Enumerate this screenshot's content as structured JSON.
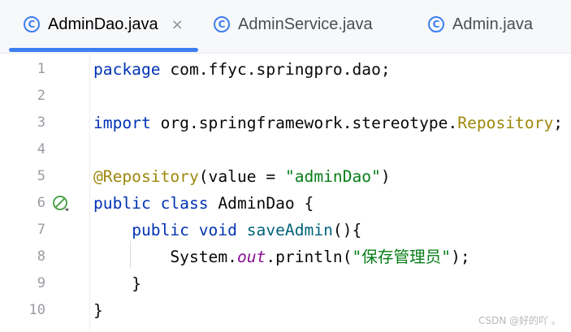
{
  "tabs": [
    {
      "label": "AdminDao.java",
      "icon": "class-c-icon",
      "active": true,
      "close": "×"
    },
    {
      "label": "AdminService.java",
      "icon": "class-c-icon",
      "active": false
    },
    {
      "label": "Admin.java",
      "icon": "class-c-icon",
      "active": false
    }
  ],
  "tab_icon_glyph": "C",
  "lines": [
    {
      "num": "1",
      "tokens": [
        {
          "t": "package",
          "c": "kw"
        },
        {
          "t": " com.ffyc.springpro.dao;",
          "c": ""
        }
      ]
    },
    {
      "num": "2",
      "tokens": []
    },
    {
      "num": "3",
      "tokens": [
        {
          "t": "import",
          "c": "kw"
        },
        {
          "t": " org.springframework.stereotype.",
          "c": ""
        },
        {
          "t": "Repository",
          "c": "ann"
        },
        {
          "t": ";",
          "c": ""
        }
      ]
    },
    {
      "num": "4",
      "tokens": []
    },
    {
      "num": "5",
      "tokens": [
        {
          "t": "@Repository",
          "c": "ann"
        },
        {
          "t": "(value = ",
          "c": ""
        },
        {
          "t": "\"adminDao\"",
          "c": "str"
        },
        {
          "t": ")",
          "c": ""
        }
      ]
    },
    {
      "num": "6",
      "tokens": [
        {
          "t": "public",
          "c": "kw"
        },
        {
          "t": " ",
          "c": ""
        },
        {
          "t": "class",
          "c": "kw"
        },
        {
          "t": " AdminDao {",
          "c": ""
        }
      ],
      "gutter_icon": "bean-icon"
    },
    {
      "num": "7",
      "tokens": [
        {
          "t": "    ",
          "c": ""
        },
        {
          "t": "public",
          "c": "kw"
        },
        {
          "t": " ",
          "c": ""
        },
        {
          "t": "void",
          "c": "kw"
        },
        {
          "t": " ",
          "c": ""
        },
        {
          "t": "saveAdmin",
          "c": "fn"
        },
        {
          "t": "(){",
          "c": ""
        }
      ]
    },
    {
      "num": "8",
      "tokens": [
        {
          "t": "        System.",
          "c": ""
        },
        {
          "t": "out",
          "c": "fld"
        },
        {
          "t": ".println(",
          "c": ""
        },
        {
          "t": "\"保存管理员\"",
          "c": "str"
        },
        {
          "t": ");",
          "c": ""
        }
      ]
    },
    {
      "num": "9",
      "tokens": [
        {
          "t": "    }",
          "c": ""
        }
      ]
    },
    {
      "num": "10",
      "tokens": [
        {
          "t": "}",
          "c": ""
        }
      ]
    }
  ],
  "watermark": "CSDN @好的吖 。",
  "colors": {
    "accent": "#3d7ef0",
    "keyword": "#0033b3",
    "annotation": "#9e880d",
    "string": "#067d17",
    "field": "#871094",
    "method": "#00627a"
  }
}
